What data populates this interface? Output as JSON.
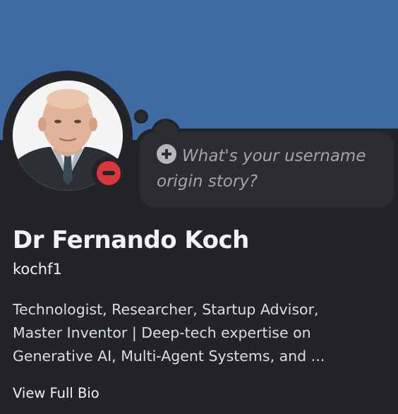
{
  "profile": {
    "display_name": "Dr Fernando Koch",
    "username": "kochf1",
    "status": "do-not-disturb",
    "bio_lines": [
      "Technologist, Researcher, Startup Advisor,",
      "Master Inventor | Deep-tech expertise on",
      "Generative AI, Multi-Agent Systems, and ..."
    ],
    "view_bio_label": "View Full Bio"
  },
  "status_prompt": {
    "icon": "plus-circle-icon",
    "text_line1": "What's your username",
    "text_line2": "origin story?"
  },
  "colors": {
    "banner": "#3f6ba5",
    "card": "#232428",
    "bubble": "#2b2d31",
    "dnd": "#da373c"
  }
}
